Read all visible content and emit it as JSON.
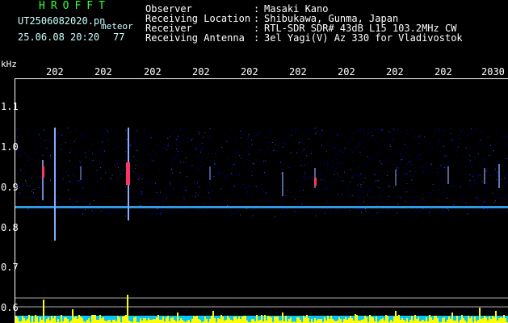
{
  "header": {
    "brand": "HROFFT",
    "filename": "UT2506082020.pn",
    "mode": "meteor",
    "datetime": "25.06.08 20:20",
    "count": "77",
    "rows": [
      {
        "label": "Observer",
        "colon": ":",
        "value": "Masaki Kano"
      },
      {
        "label": "Receiving Location",
        "colon": ":",
        "value": "Shibukawa, Gunma, Japan"
      },
      {
        "label": "Receiver",
        "colon": ":",
        "value": "RTL-SDR SDR# 43dB L15 103.2MHz CW"
      },
      {
        "label": "Receiving Antenna",
        "colon": ":",
        "value": "3el Yagi(V) Az 330 for Vladivostok"
      }
    ]
  },
  "chart_data": {
    "type": "heatmap",
    "ylabel": "kHz",
    "x_ticks": [
      "202",
      "202",
      "202",
      "202",
      "202",
      "202",
      "202",
      "202",
      "202",
      "2030"
    ],
    "y_ticks": [
      "1.1",
      "1.0",
      "0.9",
      "0.8",
      "0.7",
      "0.6"
    ],
    "baseline_khz": 0.85,
    "colors": {
      "background": "#000000",
      "noise": "#0000cc",
      "baseline": "#33aaff",
      "strong": "#ff3366",
      "bars": "#ffff00",
      "bar_floor": "#00c8ff"
    }
  }
}
